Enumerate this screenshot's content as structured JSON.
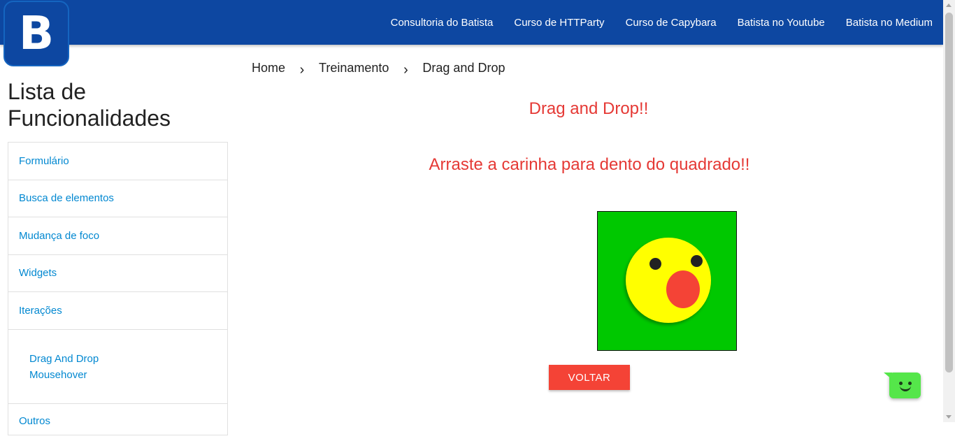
{
  "logo": {
    "letter": "B"
  },
  "navbar": {
    "links": [
      "Consultoria do Batista",
      "Curso de HTTParty",
      "Curso de Capybara",
      "Batista no Youtube",
      "Batista no Medium"
    ]
  },
  "sidebar": {
    "title": "Lista de Funcionalidades",
    "items": [
      "Formulário",
      "Busca de elementos",
      "Mudança de foco",
      "Widgets",
      "Iterações"
    ],
    "subitems": [
      "Drag And Drop",
      "Mousehover"
    ],
    "last_item": "Outros"
  },
  "breadcrumb": {
    "items": [
      "Home",
      "Treinamento",
      "Drag and Drop"
    ],
    "separator": "›"
  },
  "main": {
    "heading": "Drag and Drop!!",
    "instruction": "Arraste a carinha para dento do quadrado!!",
    "back_button": "VOLTAR"
  },
  "colors": {
    "navbar": "#0d47a1",
    "heading": "#e53935",
    "drop_box": "#00c800",
    "smiley": "#ffff00",
    "button": "#f44336",
    "link": "#0288d1",
    "chat_widget": "#55e64a"
  },
  "icons": {
    "breadcrumb_separator": "chevron-right-icon",
    "chat": "chat-smiley-icon"
  }
}
